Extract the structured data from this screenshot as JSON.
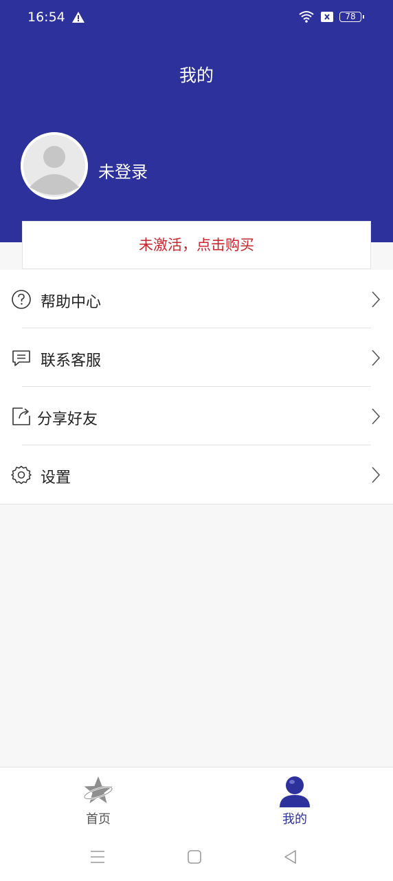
{
  "status_bar": {
    "time": "16:54",
    "battery": "78"
  },
  "header": {
    "title": "我的",
    "username": "未登录"
  },
  "activation": {
    "label": "未激活，点击购买"
  },
  "menu": {
    "items": [
      {
        "label": "帮助中心",
        "icon": "help-circle-icon"
      },
      {
        "label": "联系客服",
        "icon": "chat-icon"
      },
      {
        "label": "分享好友",
        "icon": "share-icon"
      },
      {
        "label": "设置",
        "icon": "gear-icon"
      }
    ]
  },
  "tabbar": {
    "items": [
      {
        "label": "首页",
        "icon": "star-planet-icon",
        "active": false
      },
      {
        "label": "我的",
        "icon": "person-icon",
        "active": true
      }
    ]
  },
  "colors": {
    "brand": "#2d319b",
    "activation_text": "#c8252c",
    "background": "#f7f7f7"
  }
}
